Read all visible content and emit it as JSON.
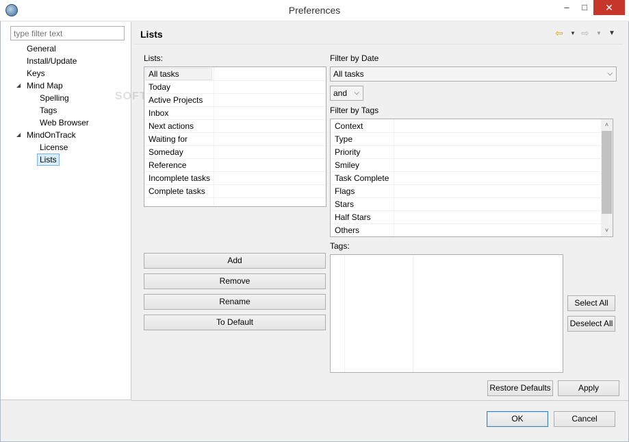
{
  "window": {
    "title": "Preferences",
    "minimize": "–",
    "maximize": "□",
    "close": "✕"
  },
  "filter": {
    "placeholder": "type filter text"
  },
  "tree": {
    "general": "General",
    "install_update": "Install/Update",
    "keys": "Keys",
    "mind_map": "Mind Map",
    "spelling": "Spelling",
    "tags": "Tags",
    "web_browser": "Web Browser",
    "mindontrack": "MindOnTrack",
    "license": "License",
    "lists": "Lists",
    "expanded_glyph": "◢"
  },
  "page": {
    "title": "Lists",
    "back_icon": "⇦",
    "forward_icon": "⇨",
    "dropdown_glyph": "▼"
  },
  "lists": {
    "label": "Lists:",
    "items": [
      "All tasks",
      "Today",
      "Active Projects",
      "Inbox",
      "Next actions",
      "Waiting for",
      "Someday",
      "Reference",
      "Incomplete tasks",
      "Complete tasks"
    ],
    "selected_index": 0
  },
  "buttons": {
    "add": "Add",
    "remove": "Remove",
    "rename": "Rename",
    "to_default": "To Default",
    "select_all": "Select All",
    "deselect_all": "Deselect All",
    "restore_defaults": "Restore Defaults",
    "apply": "Apply",
    "ok": "OK",
    "cancel": "Cancel"
  },
  "filter_by_date": {
    "label": "Filter by Date",
    "selected": "All tasks",
    "operator": "and",
    "arrow": "⌵"
  },
  "filter_by_tags": {
    "label": "Filter by Tags",
    "items": [
      "Context",
      "Type",
      "Priority",
      "Smiley",
      "Task Complete",
      "Flags",
      "Stars",
      "Half Stars",
      "Others"
    ],
    "scroll_up": "˄",
    "scroll_down": "˅"
  },
  "tags": {
    "label": "Tags:",
    "items": []
  },
  "watermark": "SOFTPEDIA"
}
